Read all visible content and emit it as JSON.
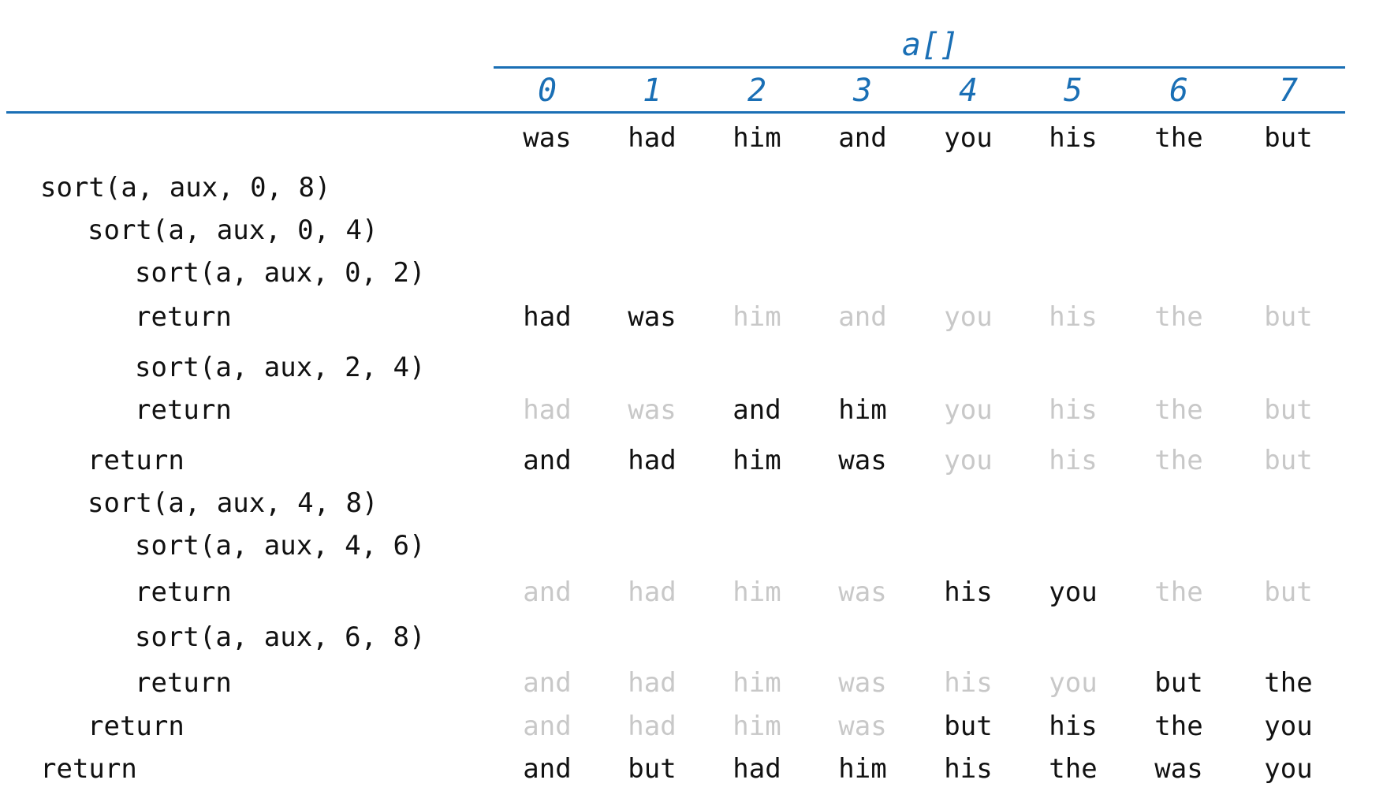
{
  "header": {
    "array_label": "a[]",
    "indices": [
      "0",
      "1",
      "2",
      "3",
      "4",
      "5",
      "6",
      "7"
    ]
  },
  "colors": {
    "accent": "#1a6fb5",
    "active": "#111111",
    "inactive": "#c8c8c8"
  },
  "initial": {
    "call": "",
    "indent": 0,
    "values": [
      "was",
      "had",
      "him",
      "and",
      "you",
      "his",
      "the",
      "but"
    ],
    "active": [
      1,
      1,
      1,
      1,
      1,
      1,
      1,
      1
    ]
  },
  "rows": [
    {
      "call": "sort(a, aux, 0, 8)",
      "indent": 0,
      "values": []
    },
    {
      "call": "sort(a, aux, 0, 4)",
      "indent": 1,
      "values": []
    },
    {
      "call": "sort(a, aux, 0, 2)",
      "indent": 2,
      "values": []
    },
    {
      "call": "return",
      "indent": 2,
      "values": [
        "had",
        "was",
        "him",
        "and",
        "you",
        "his",
        "the",
        "but"
      ],
      "active": [
        1,
        1,
        0,
        0,
        0,
        0,
        0,
        0
      ]
    },
    {
      "call": "sort(a, aux, 2, 4)",
      "indent": 2,
      "values": []
    },
    {
      "call": "return",
      "indent": 2,
      "values": [
        "had",
        "was",
        "and",
        "him",
        "you",
        "his",
        "the",
        "but"
      ],
      "active": [
        0,
        0,
        1,
        1,
        0,
        0,
        0,
        0
      ]
    },
    {
      "call": "return",
      "indent": 1,
      "values": [
        "and",
        "had",
        "him",
        "was",
        "you",
        "his",
        "the",
        "but"
      ],
      "active": [
        1,
        1,
        1,
        1,
        0,
        0,
        0,
        0
      ]
    },
    {
      "call": "sort(a, aux, 4, 8)",
      "indent": 1,
      "values": []
    },
    {
      "call": "sort(a, aux, 4, 6)",
      "indent": 2,
      "values": []
    },
    {
      "call": "return",
      "indent": 2,
      "values": [
        "and",
        "had",
        "him",
        "was",
        "his",
        "you",
        "the",
        "but"
      ],
      "active": [
        0,
        0,
        0,
        0,
        1,
        1,
        0,
        0
      ]
    },
    {
      "call": "sort(a, aux, 6, 8)",
      "indent": 2,
      "values": []
    },
    {
      "call": "return",
      "indent": 2,
      "values": [
        "and",
        "had",
        "him",
        "was",
        "his",
        "you",
        "but",
        "the"
      ],
      "active": [
        0,
        0,
        0,
        0,
        0,
        0,
        1,
        1
      ]
    },
    {
      "call": "return",
      "indent": 1,
      "values": [
        "and",
        "had",
        "him",
        "was",
        "but",
        "his",
        "the",
        "you"
      ],
      "active": [
        0,
        0,
        0,
        0,
        1,
        1,
        1,
        1
      ]
    },
    {
      "call": "return",
      "indent": 0,
      "values": [
        "and",
        "but",
        "had",
        "him",
        "his",
        "the",
        "was",
        "you"
      ],
      "active": [
        1,
        1,
        1,
        1,
        1,
        1,
        1,
        1
      ]
    }
  ]
}
